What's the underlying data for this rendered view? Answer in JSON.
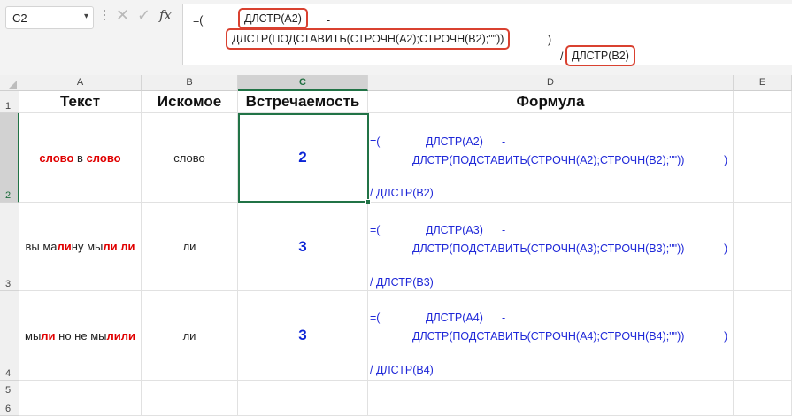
{
  "name_box": {
    "value": "C2",
    "arrow": "▾"
  },
  "formula_bar": {
    "fx": "fx",
    "cancel": "✕",
    "confirm": "✓",
    "part1_open": "=(",
    "part1_len": "ДЛСТР(A2)",
    "part1_minus": "-",
    "part2": "ДЛСТР(ПОДСТАВИТЬ(СТРОЧН(A2);СТРОЧН(B2);\"\"))",
    "part2_close": ")",
    "part3_slash": "/",
    "part3_len": "ДЛСТР(B2)"
  },
  "columns": [
    "A",
    "B",
    "C",
    "D",
    "E"
  ],
  "rows": [
    "1",
    "2",
    "3",
    "4",
    "5",
    "6"
  ],
  "headers": {
    "a": "Текст",
    "b": "Искомое",
    "c": "Встречаемость",
    "d": "Формула"
  },
  "data_rows": [
    {
      "text": [
        {
          "t": "слово",
          "red": true
        },
        {
          "t": " в ",
          "red": false
        },
        {
          "t": "слово",
          "red": true
        }
      ],
      "search": "слово",
      "count": "2",
      "f_open": "=(",
      "f_len": "ДЛСТР(A2)",
      "f_minus": "-",
      "f_sub": "ДЛСТР(ПОДСТАВИТЬ(СТРОЧН(A2);СТРОЧН(B2);\"\"))",
      "f_close": ")",
      "f_div": "/ ДЛСТР(B2)"
    },
    {
      "text": [
        {
          "t": "вы ма",
          "red": false
        },
        {
          "t": "ли",
          "red": true
        },
        {
          "t": "ну мы",
          "red": false
        },
        {
          "t": "ли",
          "red": true
        },
        {
          "t": " ",
          "red": false
        },
        {
          "t": "ли",
          "red": true
        }
      ],
      "search": "ли",
      "count": "3",
      "f_open": "=(",
      "f_len": "ДЛСТР(A3)",
      "f_minus": "-",
      "f_sub": "ДЛСТР(ПОДСТАВИТЬ(СТРОЧН(A3);СТРОЧН(B3);\"\"))",
      "f_close": ")",
      "f_div": "/ ДЛСТР(B3)"
    },
    {
      "text": [
        {
          "t": "мы",
          "red": false
        },
        {
          "t": "ли",
          "red": true
        },
        {
          "t": " но не мы",
          "red": false
        },
        {
          "t": "ли",
          "red": true
        },
        {
          "t": "ли",
          "red": true
        }
      ],
      "search": "ли",
      "count": "3",
      "f_open": "=(",
      "f_len": "ДЛСТР(A4)",
      "f_minus": "-",
      "f_sub": "ДЛСТР(ПОДСТАВИТЬ(СТРОЧН(A4);СТРОЧН(B4);\"\"))",
      "f_close": ")",
      "f_div": "/ ДЛСТР(B4)"
    }
  ]
}
